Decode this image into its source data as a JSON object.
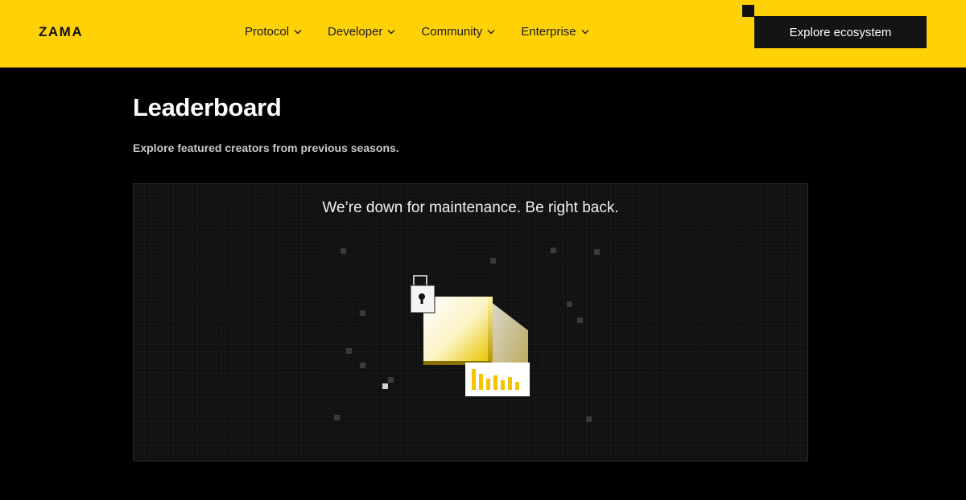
{
  "header": {
    "logo": "ZAMA",
    "nav": [
      {
        "label": "Protocol"
      },
      {
        "label": "Developer"
      },
      {
        "label": "Community"
      },
      {
        "label": "Enterprise"
      }
    ],
    "cta_label": "Explore ecosystem"
  },
  "main": {
    "title": "Leaderboard",
    "subtitle": "Explore featured creators from previous seasons.",
    "maintenance_message": "We’re down for maintenance. Be right back."
  },
  "colors": {
    "brand_yellow": "#FFD208",
    "background": "#000000",
    "cta_background": "#141414"
  },
  "icons": [
    "chevron-down-icon",
    "padlock-icon",
    "bar-chart-icon"
  ]
}
